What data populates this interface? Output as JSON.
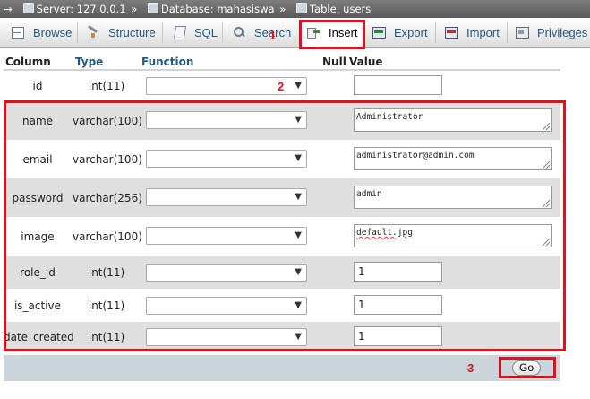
{
  "breadcrumb": {
    "server": "Server: 127.0.0.1",
    "database": "Database: mahasiswa",
    "table": "Table: users",
    "separator": "»",
    "back_arrow": "→"
  },
  "tabs": [
    {
      "label": "Browse",
      "icon": "browse-icon"
    },
    {
      "label": "Structure",
      "icon": "structure-icon"
    },
    {
      "label": "SQL",
      "icon": "sql-icon"
    },
    {
      "label": "Search",
      "icon": "search-icon"
    },
    {
      "label": "Insert",
      "icon": "insert-icon",
      "active": true
    },
    {
      "label": "Export",
      "icon": "export-icon"
    },
    {
      "label": "Import",
      "icon": "import-icon"
    },
    {
      "label": "Privileges",
      "icon": "privileges-icon"
    }
  ],
  "table": {
    "headers": {
      "column": "Column",
      "type": "Type",
      "function": "Function",
      "null": "Null",
      "value": "Value"
    },
    "rows": [
      {
        "column": "id",
        "type": "int(11)",
        "value": ""
      },
      {
        "column": "name",
        "type": "varchar(100)",
        "value": "Administrator"
      },
      {
        "column": "email",
        "type": "varchar(100)",
        "value": "administrator@admin.com"
      },
      {
        "column": "password",
        "type": "varchar(256)",
        "value": "admin"
      },
      {
        "column": "image",
        "type": "varchar(100)",
        "value": "default.jpg"
      },
      {
        "column": "role_id",
        "type": "int(11)",
        "value": "1"
      },
      {
        "column": "is_active",
        "type": "int(11)",
        "value": "1"
      },
      {
        "column": "date_created",
        "type": "int(11)",
        "value": "1"
      }
    ]
  },
  "dropdown_arrow": "▼",
  "go_label": "Go",
  "annotations": {
    "n1": "1",
    "n2": "2",
    "n3": "3",
    "color": "#e0111b"
  }
}
